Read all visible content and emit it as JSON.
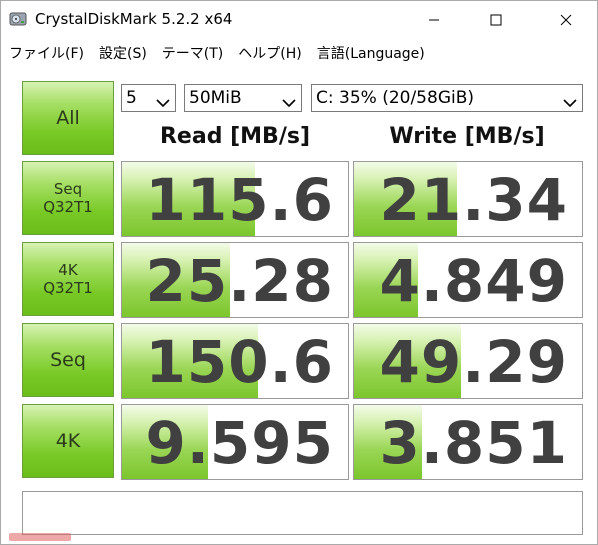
{
  "window": {
    "title": "CrystalDiskMark 5.2.2 x64",
    "icon": "disk-icon",
    "controls": [
      "minimize-icon",
      "maximize-icon",
      "close-icon"
    ]
  },
  "menu": [
    {
      "label": "ファイル(F)"
    },
    {
      "label": "設定(S)"
    },
    {
      "label": "テーマ(T)"
    },
    {
      "label": "ヘルプ(H)"
    },
    {
      "label": "言語(Language)"
    }
  ],
  "controls": {
    "all_label": "All",
    "count_value": "5",
    "size_value": "50MiB",
    "drive_value": "C: 35% (20/58GiB)"
  },
  "headers": {
    "read": "Read [MB/s]",
    "write": "Write [MB/s]"
  },
  "tests": [
    {
      "line1": "Seq",
      "line2": "Q32T1",
      "read": "115.6",
      "write": "21.34",
      "read_fill": 0.59,
      "write_fill": 0.45
    },
    {
      "line1": "4K",
      "line2": "Q32T1",
      "read": "25.28",
      "write": "4.849",
      "read_fill": 0.48,
      "write_fill": 0.28
    },
    {
      "line1": "Seq",
      "line2": "",
      "read": "150.6",
      "write": "49.29",
      "read_fill": 0.6,
      "write_fill": 0.47
    },
    {
      "line1": "4K",
      "line2": "",
      "read": "9.595",
      "write": "3.851",
      "read_fill": 0.38,
      "write_fill": 0.3
    }
  ],
  "colors": {
    "accent_green": "#7cc62d",
    "button_green": "#78c926",
    "value_text": "#404040"
  }
}
